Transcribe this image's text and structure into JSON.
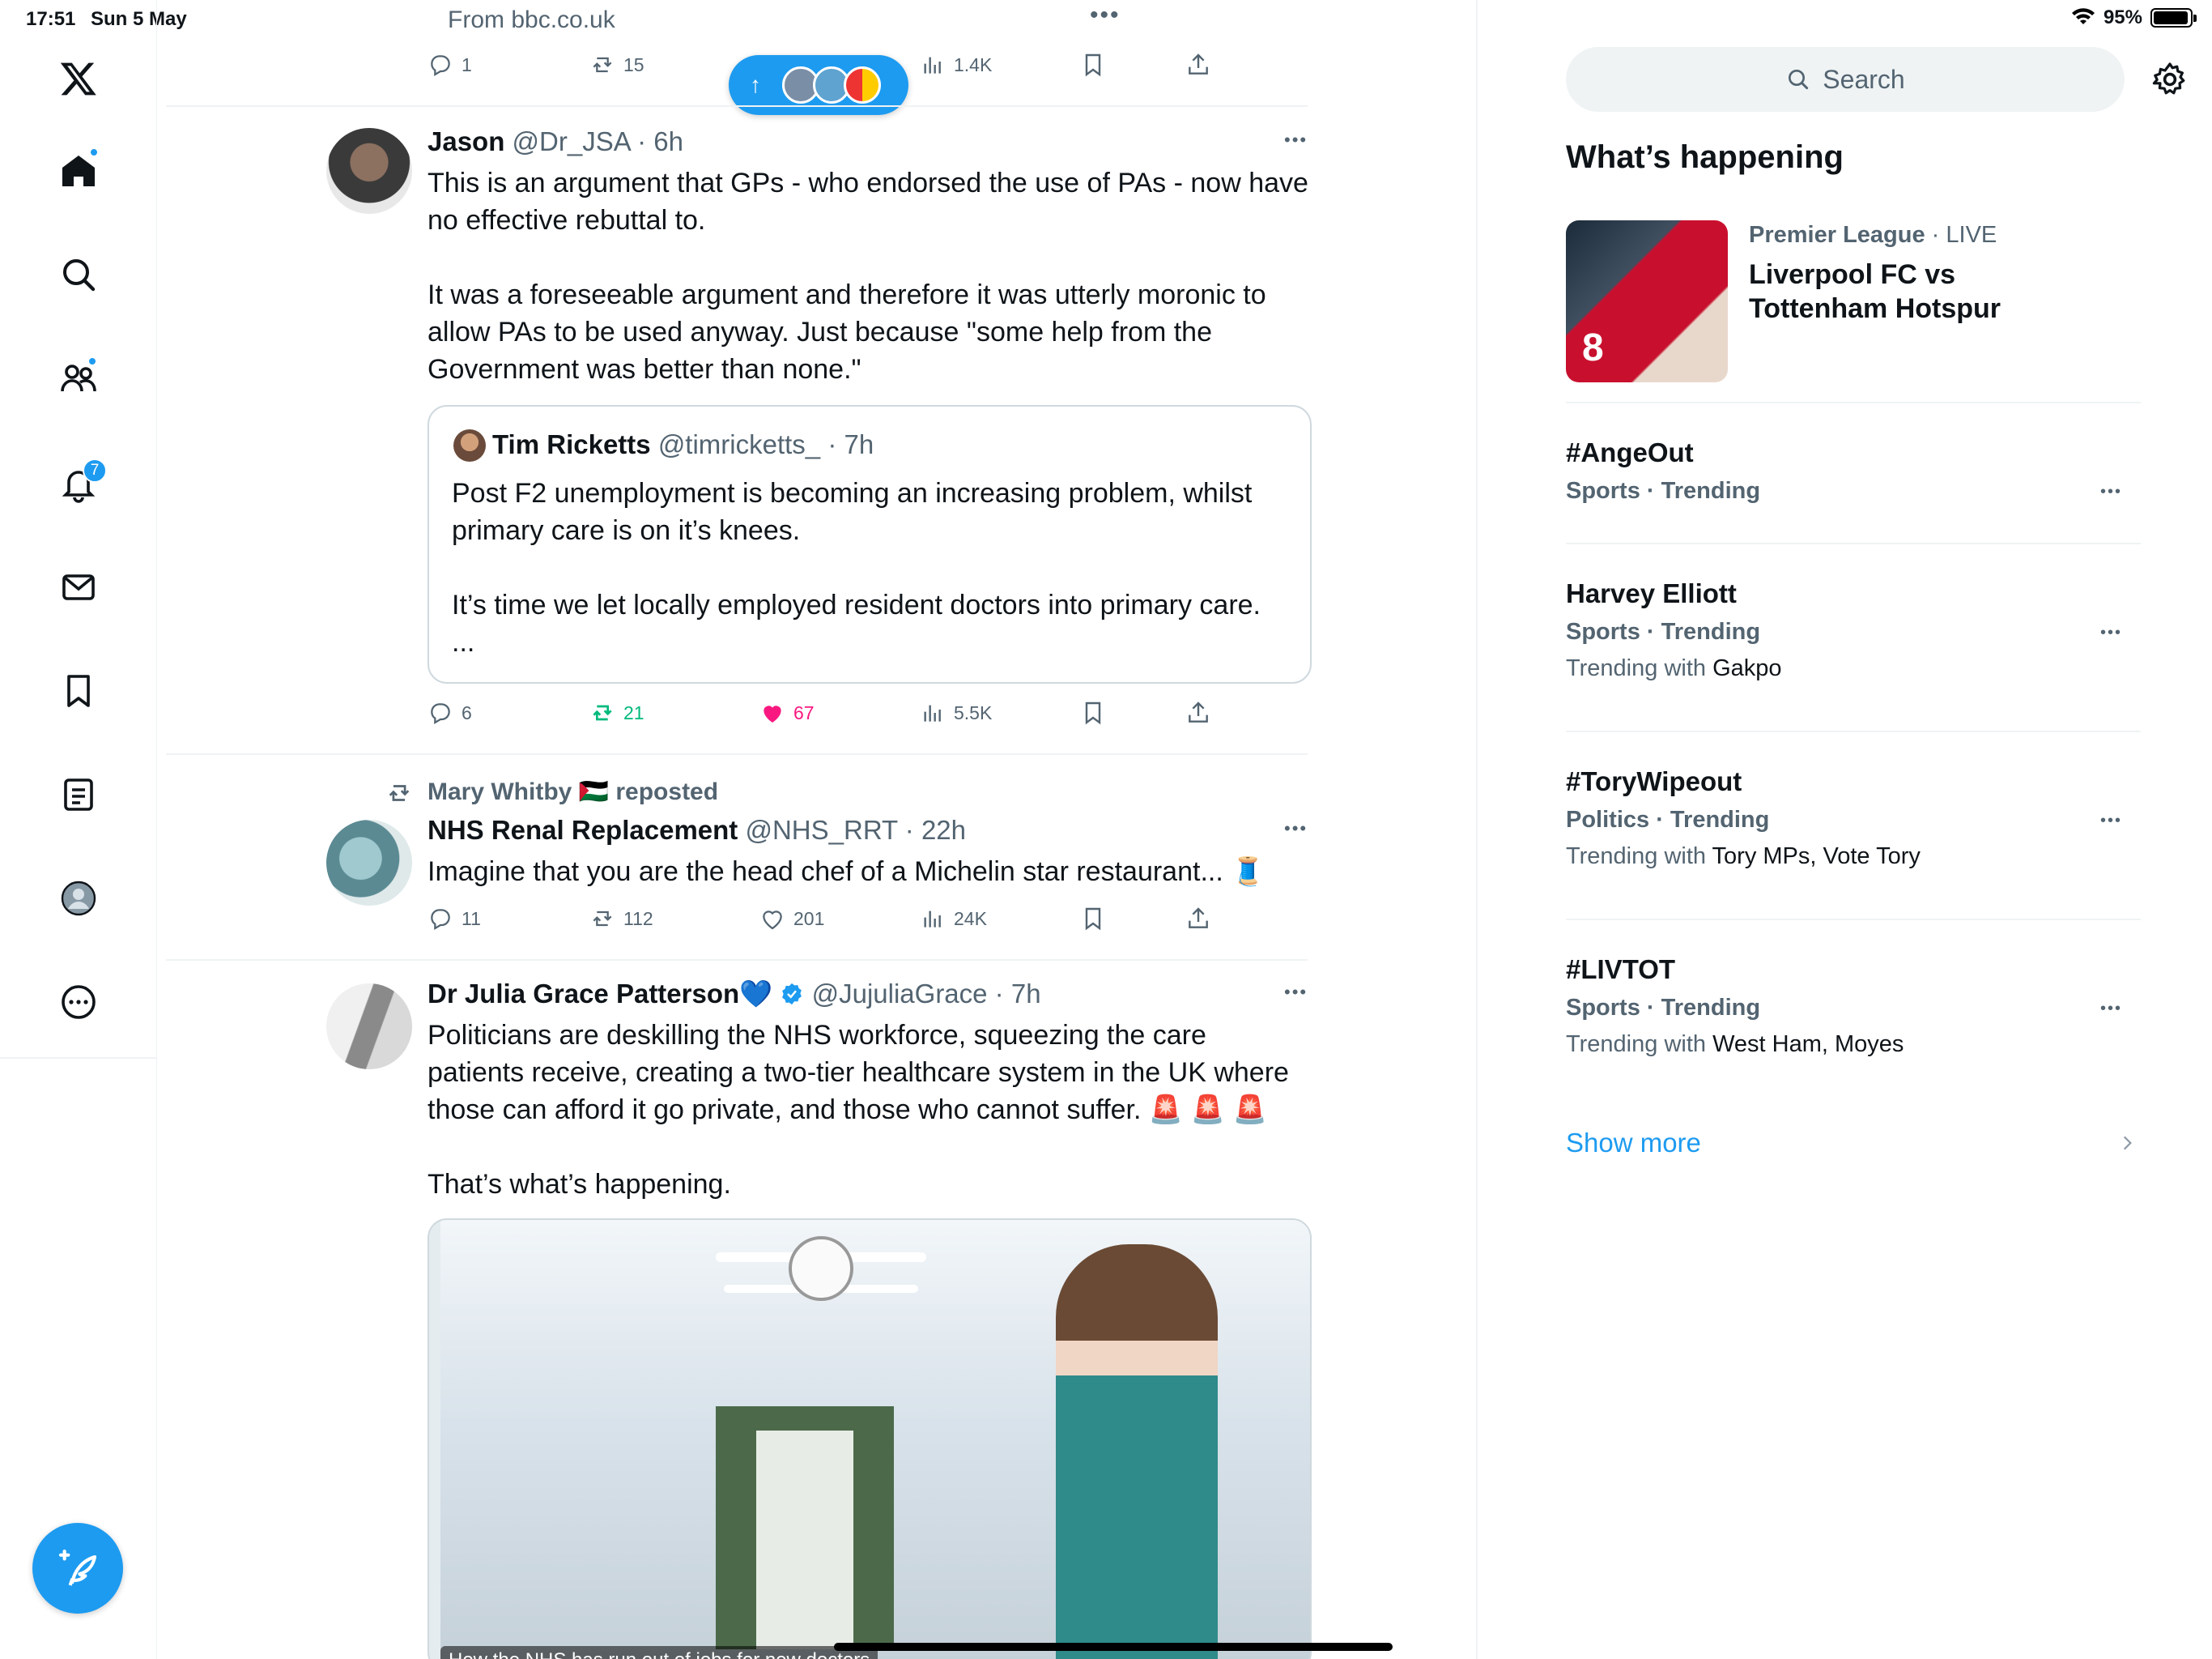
{
  "status_bar": {
    "time": "17:51",
    "date": "Sun 5 May",
    "battery": "95%",
    "battery_level": 0.95
  },
  "nav": {
    "notifications_badge": "7"
  },
  "feed": {
    "source_line": "From bbc.co.uk",
    "new_posts_arrow": "↑",
    "top_actions": {
      "replies": "1",
      "reposts": "15",
      "views": "1.4K"
    },
    "tweets": [
      {
        "name": "Jason",
        "handle": "@Dr_JSA",
        "time": "6h",
        "text": "This is an argument that GPs - who endorsed the use of PAs - now have\nno effective rebuttal to.\n\nIt was a foreseeable argument and therefore it was utterly moronic to\nallow PAs to be used anyway. Just because \"some help from the\nGovernment was better than none.\"",
        "quote": {
          "name": "Tim Ricketts",
          "handle": "@timricketts_",
          "time": "7h",
          "text": "Post F2 unemployment is becoming an increasing problem, whilst\nprimary care is on it’s knees.\n\nIt’s time we let locally employed resident doctors into primary care.\n..."
        },
        "replies": "6",
        "reposts": "21",
        "likes": "67",
        "views": "5.5K"
      },
      {
        "reposted_by": "Mary Whitby 🇵🇸 reposted",
        "name": "NHS Renal Replacement",
        "handle": "@NHS_RRT",
        "time": "22h",
        "text": "Imagine that you are the head chef of a Michelin star restaurant... 🧵",
        "replies": "11",
        "reposts": "112",
        "likes": "201",
        "views": "24K"
      },
      {
        "name": "Dr Julia Grace Patterson💙",
        "handle": "@JujuliaGrace",
        "time": "7h",
        "text": "Politicians are deskilling the NHS workforce, squeezing the care\npatients receive, creating a two-tier healthcare system in the UK where\nthose can afford it go private, and those who cannot suffer. 🚨 🚨 🚨\n\nThat’s what’s happening.",
        "image_caption": "How the NHS has run out of jobs for new doctors"
      }
    ]
  },
  "sidebar": {
    "search_placeholder": "Search",
    "title": "What’s happening",
    "featured": {
      "category": "Premier League",
      "status": "LIVE",
      "title_line1": "Liverpool FC vs",
      "title_line2": "Tottenham Hotspur"
    },
    "trends": [
      {
        "name": "#AngeOut",
        "category": "Sports · Trending",
        "with_label": "",
        "with": ""
      },
      {
        "name": "Harvey Elliott",
        "category": "Sports · Trending",
        "with_label": "Trending with ",
        "with": "Gakpo"
      },
      {
        "name": "#ToryWipeout",
        "category": "Politics · Trending",
        "with_label": "Trending with ",
        "with": "Tory MPs, Vote Tory"
      },
      {
        "name": "#LIVTOT",
        "category": "Sports · Trending",
        "with_label": "Trending with ",
        "with": "West Ham, Moyes"
      }
    ],
    "show_more": "Show more"
  },
  "colors": {
    "accent": "#1d9bf0",
    "like": "#f91880",
    "repost": "#00ba7c",
    "muted": "#536471"
  }
}
